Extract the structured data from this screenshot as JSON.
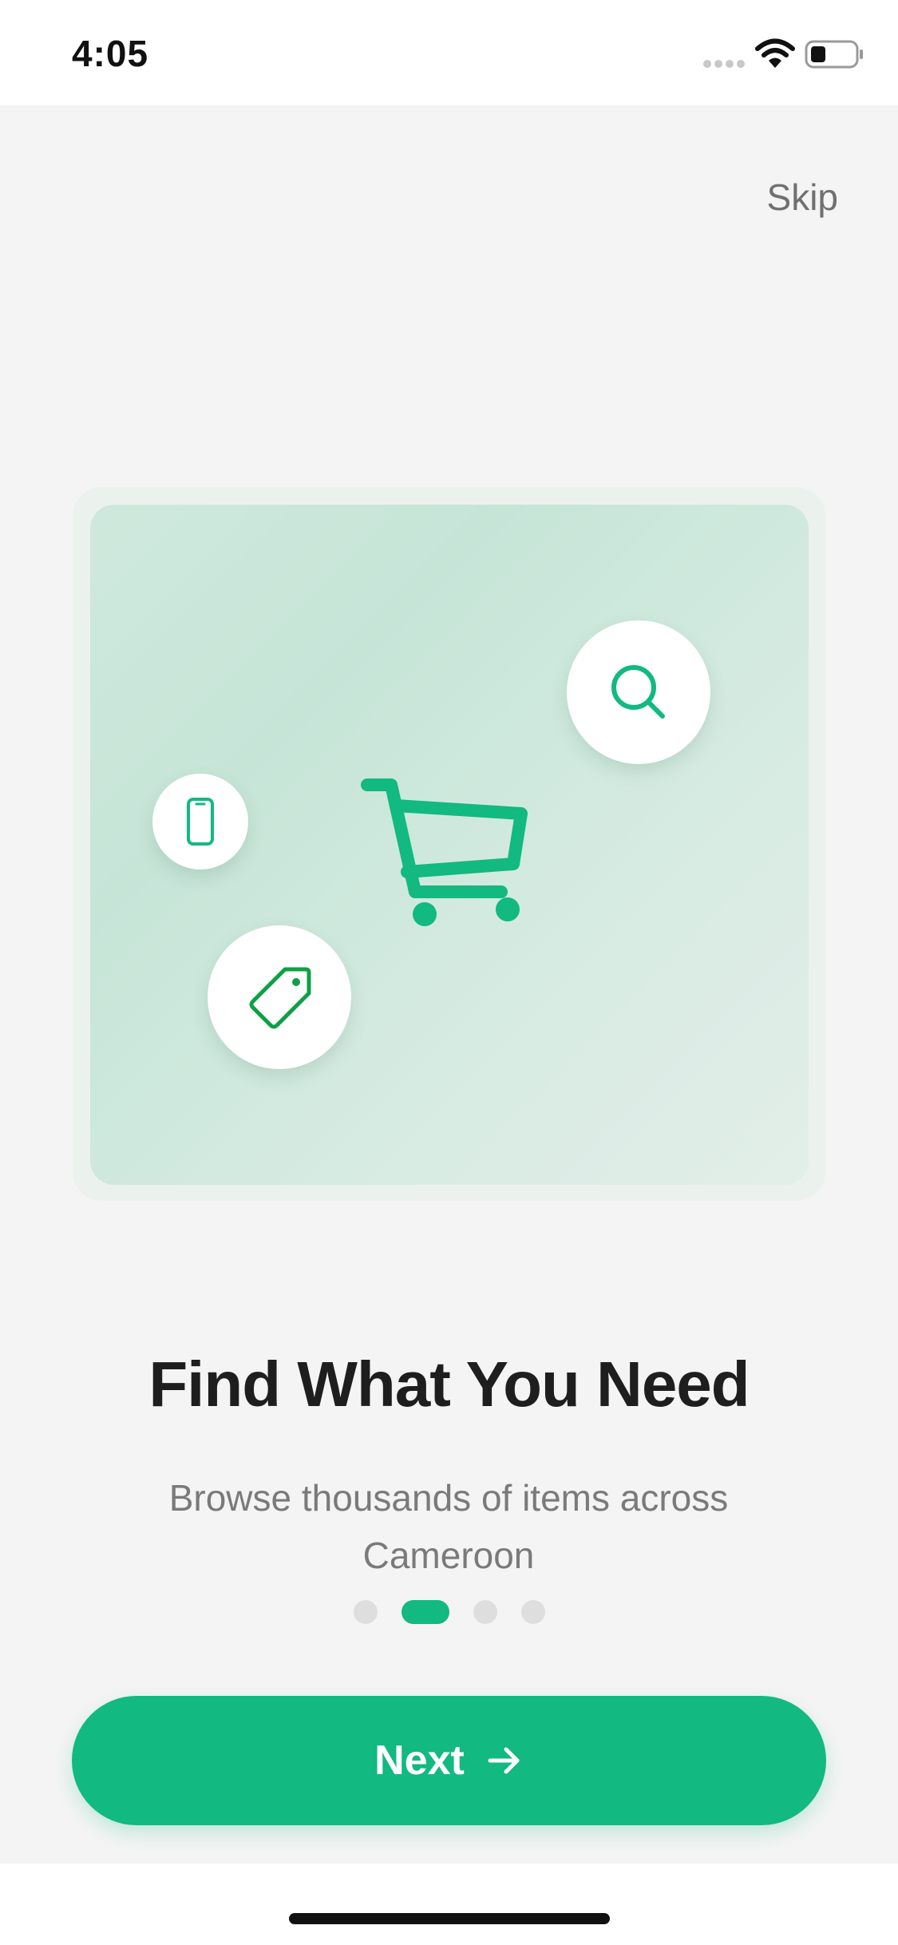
{
  "status_bar": {
    "time": "4:05",
    "icons": [
      "signal-icon",
      "wifi-icon",
      "battery-icon"
    ]
  },
  "header": {
    "skip_label": "Skip"
  },
  "illustration": {
    "icons": [
      "shopping-cart-icon",
      "search-icon",
      "smartphone-icon",
      "price-tag-icon"
    ]
  },
  "onboarding": {
    "title": "Find What You Need",
    "subtitle": "Browse thousands of items across Cameroon",
    "page_count": 4,
    "current_page": 2
  },
  "footer": {
    "next_label": "Next",
    "next_icon": "arrow-right-icon"
  },
  "colors": {
    "accent": "#12b981",
    "background": "#f4f4f4",
    "title": "#1e1e1e",
    "subtitle": "#7a7a7a",
    "skip": "#707070"
  }
}
